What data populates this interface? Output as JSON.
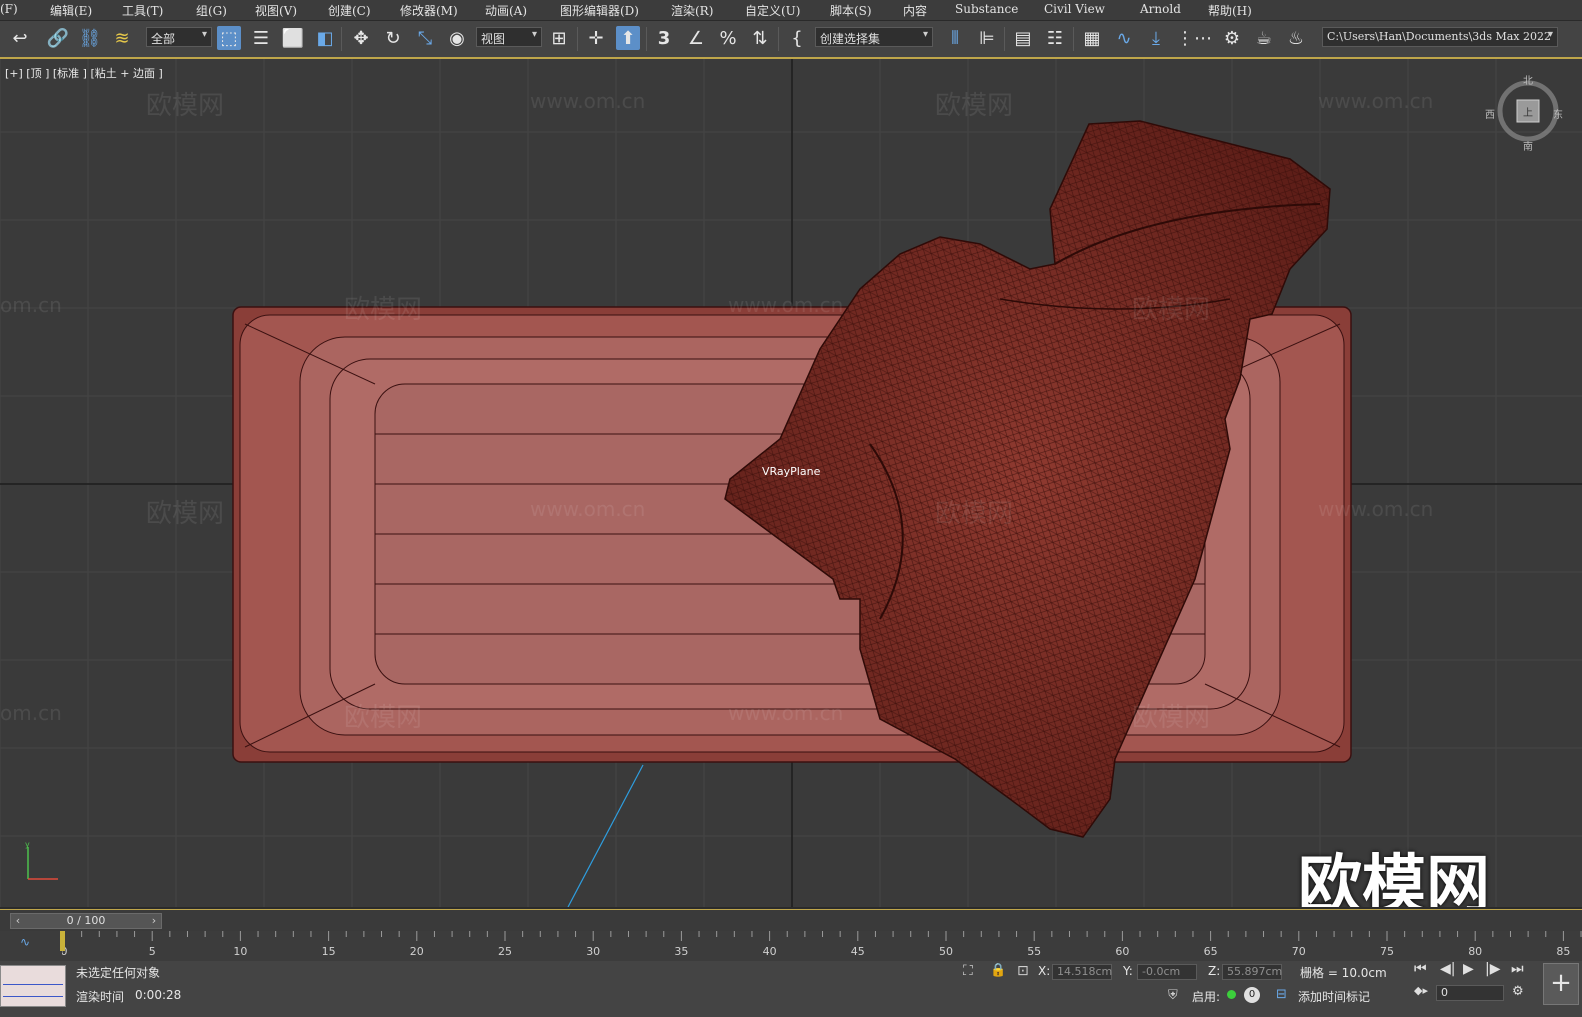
{
  "menubar": {
    "items": [
      "(F)",
      "编辑(E)",
      "工具(T)",
      "组(G)",
      "视图(V)",
      "创建(C)",
      "修改器(M)",
      "动画(A)",
      "图形编辑器(D)",
      "渲染(R)",
      "自定义(U)",
      "脚本(S)",
      "内容",
      "Substance",
      "Civil View",
      "Arnold",
      "帮助(H)"
    ]
  },
  "toolbar": {
    "selection_filter": "全部",
    "reference_coord": "视图",
    "named_selection": "创建选择集",
    "snap_angle_label": "3",
    "project_path": "C:\\Users\\Han\\Documents\\3ds Max 2022",
    "icons": [
      "undo-icon",
      "link-icon",
      "unlink-icon",
      "bind-spacewarp-icon",
      "select-object-icon",
      "select-by-name-icon",
      "rect-region-icon",
      "window-crossing-icon",
      "move-icon",
      "rotate-icon",
      "scale-icon",
      "select-place-icon",
      "pivot-icon",
      "select-manipulate-icon",
      "keyboard-shortcut-icon",
      "snap-3d-icon",
      "angle-snap-icon",
      "percent-snap-icon",
      "spinner-snap-icon",
      "edit-named-selection-icon",
      "mirror-icon",
      "align-icon",
      "layer-explorer-icon",
      "scene-explorer-icon",
      "toggle-ribbon-icon",
      "curve-editor-icon",
      "dope-sheet-icon",
      "schematic-view-icon",
      "material-editor-icon",
      "render-setup-icon",
      "rendered-frame-icon",
      "render-icon"
    ]
  },
  "viewport": {
    "label": "[+] [顶 ] [标准 ] [粘土 + 边面 ]",
    "object_label": "VRayPlane",
    "watermark_text": "欧模网",
    "watermark_url": "www.om.cn",
    "watermark_url_partial": "om.cn",
    "watermark_logo": "欧模网",
    "viewcube": {
      "face": "上",
      "north": "北",
      "south": "南",
      "east": "东",
      "west": "西"
    },
    "colors": {
      "sofa": "#a85a54",
      "cloth": "#7d2a22",
      "wire": "#3a1010",
      "grid": "#454545",
      "axis_line": "#1a1a1a",
      "light": "#2e9ee0"
    }
  },
  "timeline": {
    "slider_text": "0 / 100",
    "ticks": [
      "0",
      "5",
      "10",
      "15",
      "20",
      "25",
      "30",
      "35",
      "40",
      "45",
      "50",
      "55",
      "60",
      "65",
      "70",
      "75",
      "80",
      "85"
    ]
  },
  "statusbar": {
    "selection_status": "未选定任何对象",
    "render_time_label": "渲染时间",
    "render_time_value": "0:00:28",
    "x_label": "X:",
    "x_value": "14.518cm",
    "y_label": "Y:",
    "y_value": "-0.0cm",
    "z_label": "Z:",
    "z_value": "55.897cm",
    "grid_label": "栅格 = 10.0cm",
    "enable_label": "启用:",
    "enable_count": "0",
    "add_time_tag": "添加时间标记",
    "current_frame": "0"
  }
}
